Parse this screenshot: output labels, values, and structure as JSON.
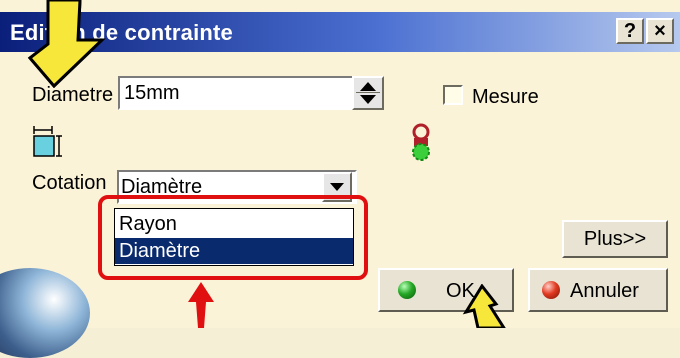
{
  "window": {
    "title": "Edition de contrainte",
    "title_buttons": {
      "help": "?",
      "close": "×"
    }
  },
  "form": {
    "diametre_label": "Diametre",
    "diametre_value": "15mm",
    "mesure_label": "Mesure",
    "mesure_checked": false,
    "cotation_label": "Cotation",
    "cotation_value": "Diamètre",
    "cotation_options": [
      "Rayon",
      "Diamètre"
    ],
    "cotation_selected_index": 1
  },
  "buttons": {
    "plus": "Plus>>",
    "ok": "OK",
    "annuler": "Annuler"
  },
  "icons": {
    "dimension": "diameter-dimension-icon",
    "status": "constraint-status-icon",
    "ok": "green-ball-icon",
    "annuler": "red-ball-icon"
  },
  "colors": {
    "title_bar": "#0a1f7a",
    "background": "#fbf3d7",
    "selection": "#0a2a6e",
    "highlight_frame": "#e01010",
    "annotation_arrow": "#f7e73a"
  }
}
